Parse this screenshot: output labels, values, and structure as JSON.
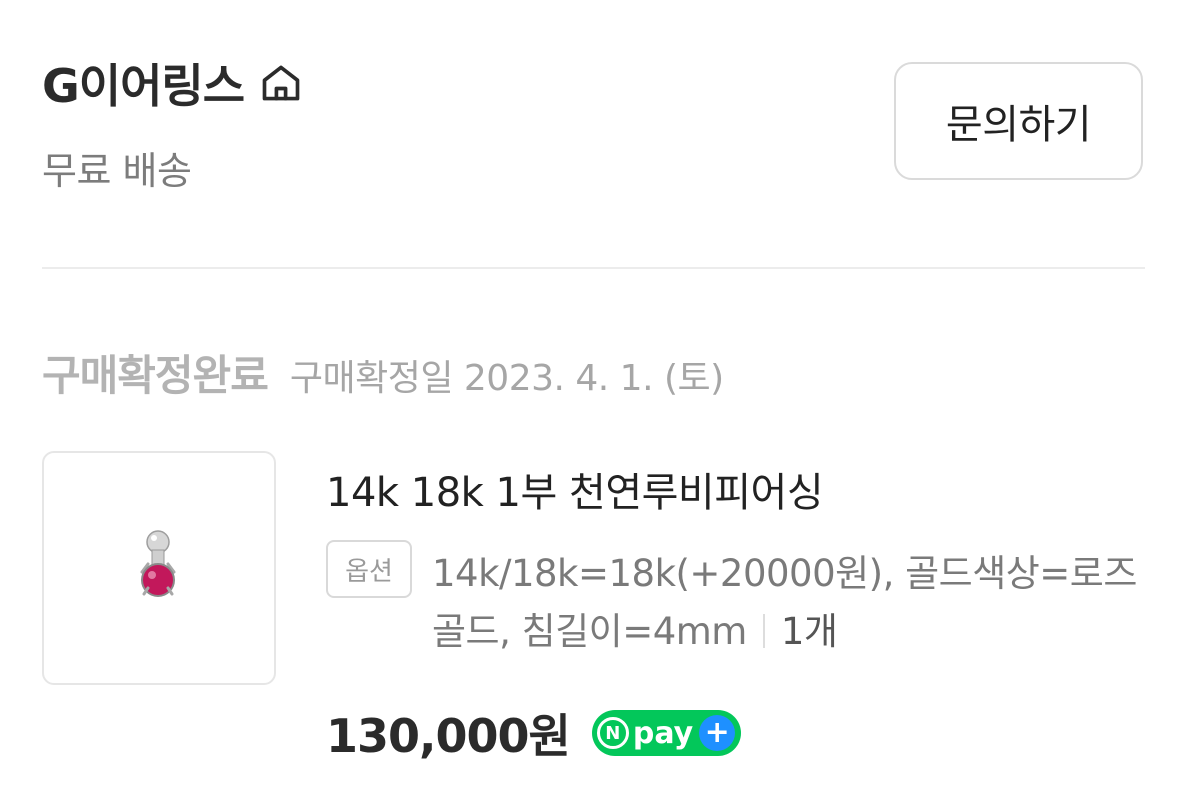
{
  "store": {
    "name": "G이어링스",
    "shipping": "무료 배송",
    "home_icon": "home-icon"
  },
  "actions": {
    "inquiry_label": "문의하기"
  },
  "order": {
    "status": "구매확정완료",
    "confirm_date": "구매확정일 2023. 4. 1. (토)"
  },
  "product": {
    "title": "14k 18k 1부 천연루비피어싱",
    "option_badge": "옵션",
    "option_text": "14k/18k=18k(+20000원), 골드색상=로즈골드, 침길이=4mm",
    "quantity": "1개",
    "price": "130,000원",
    "payment_badge": {
      "n_letter": "N",
      "text": "pay",
      "plus": "+"
    }
  },
  "colors": {
    "npay_green": "#03c75a",
    "npay_plus_blue": "#1e90ff",
    "ruby": "#c2185b"
  }
}
